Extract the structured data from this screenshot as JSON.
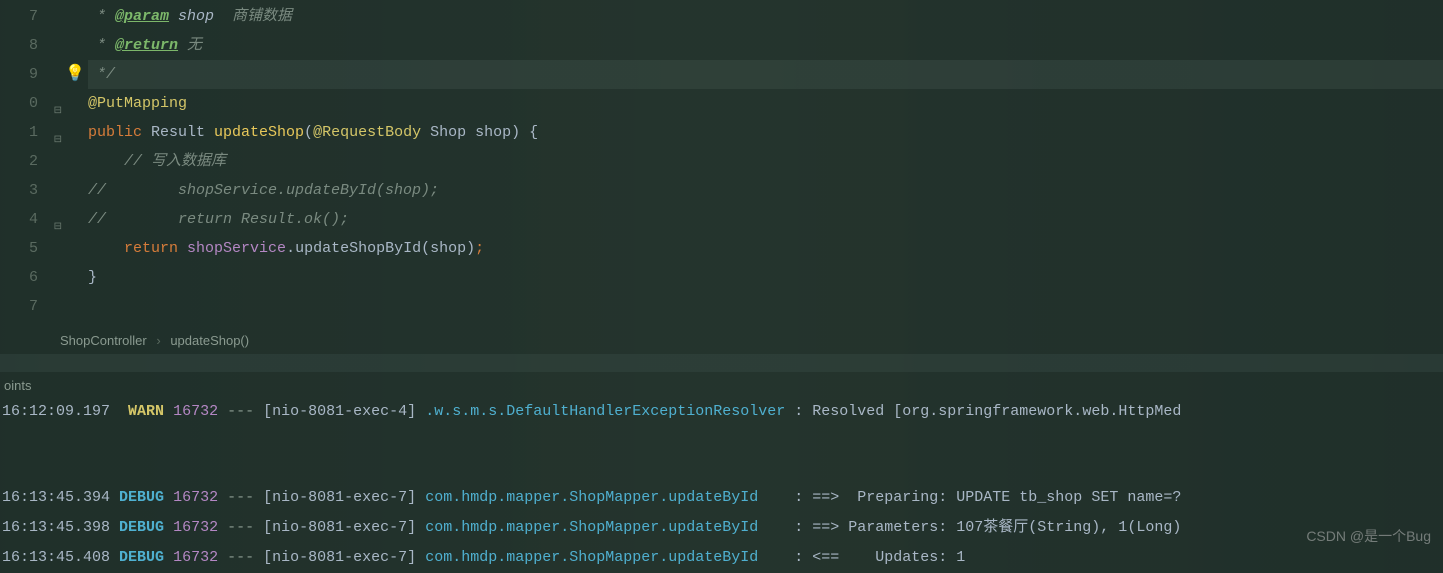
{
  "gutter": {
    "lines": [
      "7",
      "8",
      "9",
      "0",
      "1",
      "2",
      "3",
      "4",
      "5",
      "6",
      "7"
    ]
  },
  "code": {
    "l7_doctag": "@param",
    "l7_param": " shop",
    "l7_desc": "  商铺数据",
    "l8_doctag": "@return",
    "l8_desc": " 无",
    "l9": " */",
    "l10_ann": "@PutMapping",
    "l11_kw": "public ",
    "l11_type": "Result ",
    "l11_method": "updateShop",
    "l11_paren1": "(",
    "l11_ann2": "@RequestBody",
    "l11_ptype": " Shop ",
    "l11_pname": "shop",
    "l11_paren2": ") {",
    "l12_cm": "// 写入数据库",
    "l13_cm": "//        shopService.updateById(shop);",
    "l14_cm": "//        return Result.ok();",
    "l15_kw": "return ",
    "l15_field": "shopService",
    "l15_dot": ".",
    "l15_call": "updateShopById",
    "l15_p1": "(",
    "l15_arg": "shop",
    "l15_p2": ")",
    "l15_semi": ";",
    "l16": "}"
  },
  "breadcrumb": {
    "item1": "ShopController",
    "item2": "updateShop()"
  },
  "panel": {
    "title": "oints"
  },
  "logs": [
    {
      "time": "16:12:09.197",
      "level": "WARN",
      "pid": "16732",
      "thread": "[nio-8081-exec-4]",
      "logger": ".w.s.m.s.DefaultHandlerExceptionResolver",
      "msg": ": Resolved [org.springframework.web.HttpMed"
    },
    {
      "time": "16:13:45.394",
      "level": "DEBUG",
      "pid": "16732",
      "thread": "[nio-8081-exec-7]",
      "logger": "com.hmdp.mapper.ShopMapper.updateById",
      "msg": ": ==>  Preparing: UPDATE tb_shop SET name=?"
    },
    {
      "time": "16:13:45.398",
      "level": "DEBUG",
      "pid": "16732",
      "thread": "[nio-8081-exec-7]",
      "logger": "com.hmdp.mapper.ShopMapper.updateById",
      "msg": ": ==> Parameters: 107茶餐厅(String), 1(Long)"
    },
    {
      "time": "16:13:45.408",
      "level": "DEBUG",
      "pid": "16732",
      "thread": "[nio-8081-exec-7]",
      "logger": "com.hmdp.mapper.ShopMapper.updateById",
      "msg": ": <==    Updates: 1"
    }
  ],
  "watermark": "CSDN @是一个Bug"
}
